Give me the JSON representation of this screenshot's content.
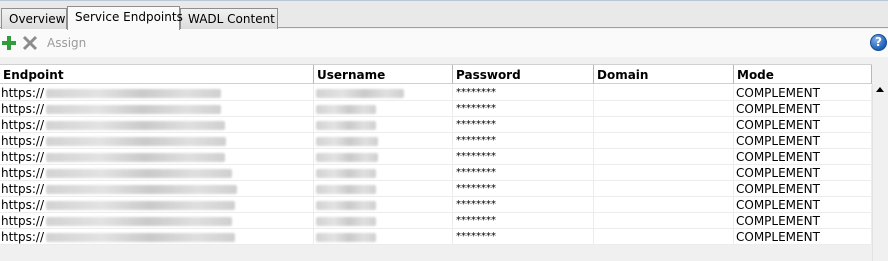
{
  "tabs": [
    {
      "label": "Overview"
    },
    {
      "label": "Service Endpoints"
    },
    {
      "label": "WADL Content"
    }
  ],
  "toolbar": {
    "add_icon": "plus-icon",
    "delete_icon": "x-icon",
    "assign_label": "Assign",
    "help_icon": "help-icon",
    "help_label": "?"
  },
  "table": {
    "columns": [
      "Endpoint",
      "Username",
      "Password",
      "Domain",
      "Mode"
    ],
    "rows": [
      {
        "endpoint": "https://",
        "username": "",
        "password": "********",
        "domain": "",
        "mode": "COMPLEMENT"
      },
      {
        "endpoint": "https://",
        "username": "",
        "password": "********",
        "domain": "",
        "mode": "COMPLEMENT"
      },
      {
        "endpoint": "https://",
        "username": "",
        "password": "********",
        "domain": "",
        "mode": "COMPLEMENT"
      },
      {
        "endpoint": "https://",
        "username": "",
        "password": "********",
        "domain": "",
        "mode": "COMPLEMENT"
      },
      {
        "endpoint": "https://",
        "username": "",
        "password": "********",
        "domain": "",
        "mode": "COMPLEMENT"
      },
      {
        "endpoint": "https://",
        "username": "",
        "password": "********",
        "domain": "",
        "mode": "COMPLEMENT"
      },
      {
        "endpoint": "https://",
        "username": "",
        "password": "********",
        "domain": "",
        "mode": "COMPLEMENT"
      },
      {
        "endpoint": "https://",
        "username": "",
        "password": "********",
        "domain": "",
        "mode": "COMPLEMENT"
      },
      {
        "endpoint": "https://",
        "username": "",
        "password": "********",
        "domain": "",
        "mode": "COMPLEMENT"
      },
      {
        "endpoint": "https://",
        "username": "",
        "password": "********",
        "domain": "",
        "mode": "COMPLEMENT"
      }
    ]
  },
  "colors": {
    "add": "#2f9e3a",
    "delete": "#8c8c8c",
    "help": "#1e5fb5"
  }
}
